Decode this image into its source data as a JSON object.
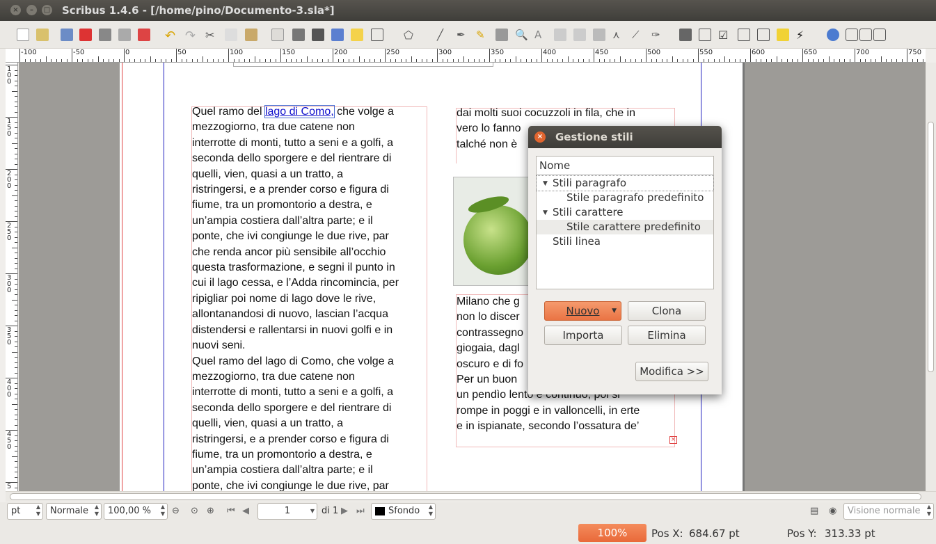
{
  "window": {
    "title": "Scribus 1.4.6 - [/home/pino/Documento-3.sla*]"
  },
  "ruler": {
    "h_labels": [
      "-100",
      "-50",
      "0",
      "50",
      "100",
      "150",
      "200",
      "250",
      "300",
      "350",
      "400",
      "450",
      "500",
      "550",
      "600",
      "650",
      "700",
      "750"
    ],
    "v_labels": [
      "100",
      "150",
      "200",
      "250",
      "300",
      "350",
      "400",
      "450",
      "5"
    ]
  },
  "document": {
    "col1_link": "lago di Como,",
    "col1_lines": [
      [
        "Quel ramo del ",
        " che volge a"
      ],
      "mezzogiorno, tra due catene non",
      "interrotte di monti, tutto a seni e a golfi, a",
      "seconda dello sporgere e del rientrare di",
      "quelli, vien, quasi a un tratto, a",
      "ristringersi, e a prender corso e figura di",
      "fiume, tra un promontorio a destra, e",
      "un’ampia costiera dall’altra parte; e il",
      "ponte, che ivi congiunge le due rive, par",
      "che renda ancor più sensibile all’occhio",
      "questa trasformazione, e segni il punto in",
      "cui il lago cessa, e l’Adda rincomincia, per",
      "ripigliar poi nome di lago dove le rive,",
      "allontanandosi di nuovo, lascian l’acqua",
      "distendersi e rallentarsi in nuovi golfi e in",
      "nuovi seni.",
      "Quel ramo del lago di Como, che volge a",
      "mezzogiorno, tra due catene non",
      "interrotte di monti, tutto a seni e a golfi, a",
      "seconda dello sporgere e del rientrare di",
      "quelli, vien, quasi a un tratto, a",
      "ristringersi, e a prender corso e figura di",
      "fiume, tra un promontorio a destra, e",
      "un’ampia costiera dall’altra parte; e il",
      "ponte, che ivi congiunge le due rive, par"
    ],
    "col2_top": [
      "dai molti suoi cocuzzoli in fila, che in",
      "vero lo fanno",
      "talché non è"
    ],
    "col2_bottom": [
      "Milano che g",
      "non lo discer",
      "contrassegno",
      "giogaia, dagl",
      "oscuro e di fo",
      "Per un buon",
      "un pendìo lento e continuo; poi si",
      "rompe in poggi e in valloncelli, in erte",
      "e in ispianate, secondo l’ossatura de’"
    ]
  },
  "dialog": {
    "title": "Gestione stili",
    "header": "Nome",
    "items": [
      {
        "label": "Stili paragrafo",
        "level": 0,
        "expanded": true
      },
      {
        "label": "Stile paragrafo predefinito",
        "level": 1
      },
      {
        "label": "Stili carattere",
        "level": 0,
        "expanded": true
      },
      {
        "label": "Stile carattere predefinito",
        "level": 1,
        "selected": true
      },
      {
        "label": "Stili linea",
        "level": 0
      }
    ],
    "buttons": {
      "new": "Nuovo",
      "clone": "Clona",
      "import": "Importa",
      "delete": "Elimina",
      "edit": "Modifica >>"
    }
  },
  "statusbar": {
    "unit": "pt",
    "mode": "Normale",
    "zoom": "100,00 %",
    "page": "1",
    "page_of": "di 1",
    "layer": "Sfondo",
    "view": "Visione normale"
  },
  "coords": {
    "progress": "100%",
    "posx_label": "Pos X:",
    "posx": "684.67 pt",
    "posy_label": "Pos Y:",
    "posy": "313.33 pt"
  },
  "colors": {
    "accent": "#e9693a",
    "link": "#1010cc",
    "margin": "#e04040",
    "guide": "#2020c0"
  }
}
